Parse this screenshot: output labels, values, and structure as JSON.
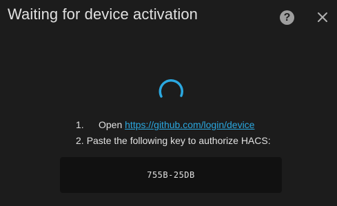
{
  "dialog": {
    "title": "Waiting for device activation",
    "help_icon": "help-circle-icon",
    "help_glyph": "?",
    "close_icon": "close-icon"
  },
  "steps": [
    {
      "number": "1.",
      "text_before": "Open",
      "link": "https://github.com/login/device"
    },
    {
      "number": "2.",
      "text": "Paste the following key to authorize HACS:"
    }
  ],
  "device_code": "755B-25DB",
  "colors": {
    "background": "#1c1c1c",
    "link": "#2ba8e0",
    "spinner": "#2ba8e0",
    "code_box": "#111111"
  }
}
